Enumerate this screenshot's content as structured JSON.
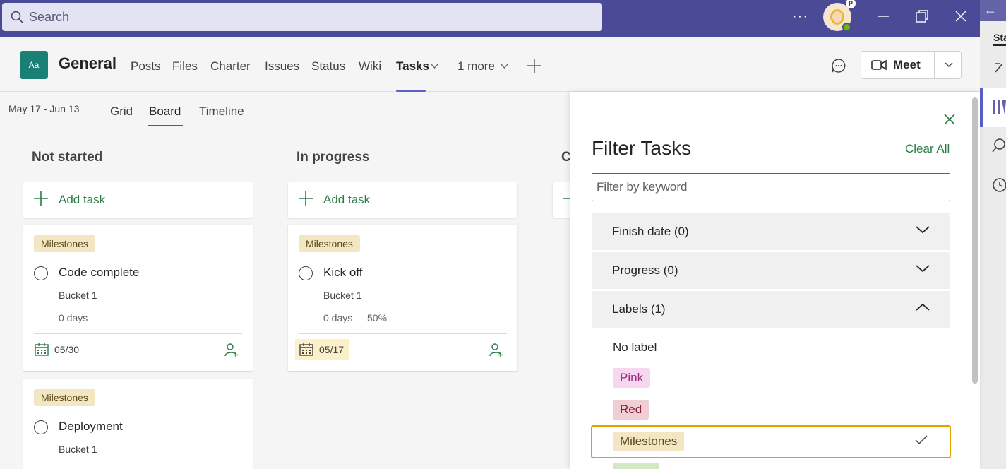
{
  "titlebar": {
    "search_placeholder": "Search",
    "more_label": "···",
    "avatar_badge": "P"
  },
  "header": {
    "team_initials": "Aa",
    "channel_name": "General",
    "tabs": [
      {
        "label": "Posts"
      },
      {
        "label": "Files"
      },
      {
        "label": "Charter"
      },
      {
        "label": "Issues"
      },
      {
        "label": "Status"
      },
      {
        "label": "Wiki"
      },
      {
        "label": "Tasks"
      },
      {
        "label": "1 more"
      }
    ],
    "meet_label": "Meet"
  },
  "board": {
    "date_range": "May 17 - Jun 13",
    "views": [
      {
        "label": "Grid"
      },
      {
        "label": "Board"
      },
      {
        "label": "Timeline"
      }
    ],
    "columns": [
      {
        "title": "Not started",
        "add_label": "Add task",
        "cards": [
          {
            "label": "Milestones",
            "title": "Code complete",
            "bucket": "Bucket 1",
            "days": "0 days",
            "due": "05/30"
          },
          {
            "label": "Milestones",
            "title": "Deployment",
            "bucket": "Bucket 1"
          }
        ]
      },
      {
        "title": "In progress",
        "add_label": "Add task",
        "cards": [
          {
            "label": "Milestones",
            "title": "Kick off",
            "bucket": "Bucket 1",
            "days": "0 days",
            "percent": "50%",
            "due": "05/17"
          }
        ]
      },
      {
        "title": "C"
      }
    ]
  },
  "filter": {
    "title": "Filter Tasks",
    "clear_label": "Clear All",
    "keyword_placeholder": "Filter by keyword",
    "sections": [
      {
        "label": "Finish date (0)",
        "expanded": false
      },
      {
        "label": "Progress (0)",
        "expanded": false
      },
      {
        "label": "Labels (1)",
        "expanded": true
      }
    ],
    "label_options": [
      {
        "label": "No label",
        "color": "",
        "selected": false
      },
      {
        "label": "Pink",
        "color": "#f7d7ef",
        "selected": false
      },
      {
        "label": "Red",
        "color": "#efcfd5",
        "selected": false
      },
      {
        "label": "Milestones",
        "color": "#f2e6c3",
        "selected": true
      }
    ]
  },
  "rail": {
    "tab_label": "Sta"
  },
  "colors": {
    "titlebar": "#4b4a97",
    "accent_green": "#2c7a45",
    "accent_purple": "#5b5fc7",
    "selected_border": "#e1a000"
  }
}
